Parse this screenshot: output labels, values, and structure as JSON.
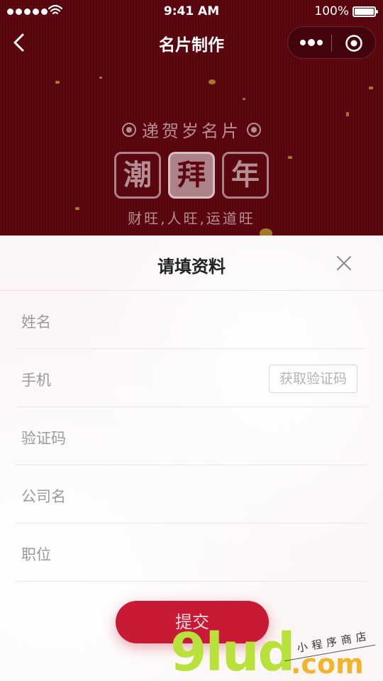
{
  "status_bar": {
    "time": "9:41 AM",
    "battery": "100%"
  },
  "nav": {
    "title": "名片制作"
  },
  "banner": {
    "subtitle": "递贺岁名片",
    "chars": [
      "潮",
      "拜",
      "年"
    ],
    "slogan": "财旺,人旺,运道旺"
  },
  "sheet": {
    "title": "请填资料",
    "fields": {
      "name": {
        "label": "姓名",
        "value": ""
      },
      "phone": {
        "label": "手机",
        "value": ""
      },
      "code": {
        "label": "验证码",
        "value": ""
      },
      "company": {
        "label": "公司名",
        "value": ""
      },
      "position": {
        "label": "职位",
        "value": ""
      }
    },
    "get_code_label": "获取验证码",
    "submit_label": "提交"
  },
  "watermark": {
    "brand": "9lud",
    "domain": ".com",
    "tagline": "小程序商店"
  },
  "colors": {
    "header_bg": "#5c0610",
    "accent": "#c81a35"
  },
  "icons": [
    "back-icon",
    "more-icon",
    "target-icon",
    "close-icon",
    "signal-icon",
    "wifi-icon",
    "battery-icon",
    "flower-icon"
  ]
}
